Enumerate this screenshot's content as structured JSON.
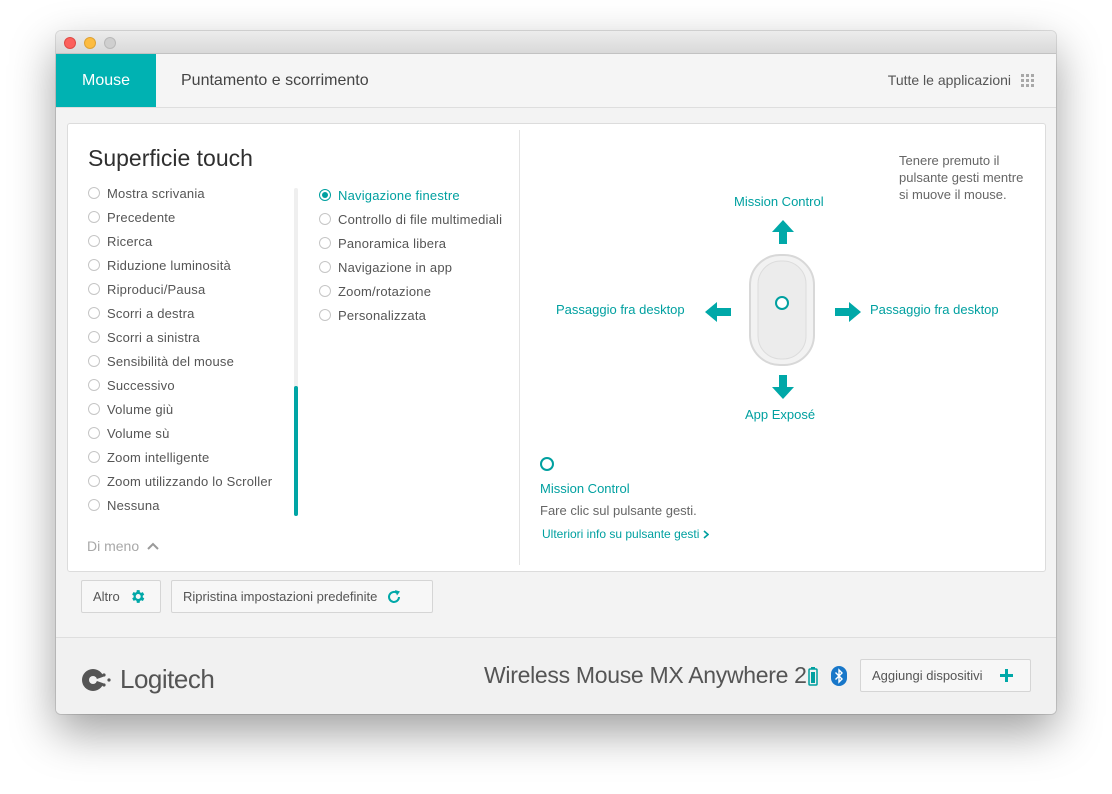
{
  "tabs": {
    "active": "Mouse",
    "second": "Puntamento e scorrimento",
    "all_apps": "Tutte le applicazioni"
  },
  "section": {
    "title": "Superficie touch"
  },
  "options_col1": [
    "Mostra scrivania",
    "Precedente",
    "Ricerca",
    "Riduzione luminosità",
    "Riproduci/Pausa",
    "Scorri a destra",
    "Scorri a sinistra",
    "Sensibilità del mouse",
    "Successivo",
    "Volume giù",
    "Volume sù",
    "Zoom intelligente",
    "Zoom utilizzando lo Scroller",
    "Nessuna"
  ],
  "options_col2": [
    "Navigazione finestre",
    "Controllo di file multimediali",
    "Panoramica libera",
    "Navigazione in app",
    "Zoom/rotazione",
    "Personalizzata"
  ],
  "selected_option": "Navigazione finestre",
  "less_toggle": "Di meno",
  "gesture": {
    "hint": "Tenere premuto il pulsante gesti mentre si muove il mouse.",
    "up": "Mission Control",
    "left": "Passaggio fra desktop",
    "right": "Passaggio fra desktop",
    "down": "App Exposé"
  },
  "info": {
    "title": "Mission Control",
    "description": "Fare clic sul pulsante gesti.",
    "link": "Ulteriori info su pulsante gesti"
  },
  "buttons": {
    "altro": "Altro",
    "reset": "Ripristina impostazioni predefinite",
    "add_device": "Aggiungi dispositivi"
  },
  "footer": {
    "brand": "Logitech",
    "device": "Wireless Mouse MX Anywhere 2"
  },
  "colors": {
    "accent": "#00b2b2",
    "accent_text": "#00a0a0"
  },
  "icons": {
    "altro": "gear-icon",
    "reset": "refresh-icon",
    "add": "plus-icon",
    "battery": "battery-icon",
    "bluetooth": "bluetooth-icon",
    "apps": "grid-icon"
  }
}
